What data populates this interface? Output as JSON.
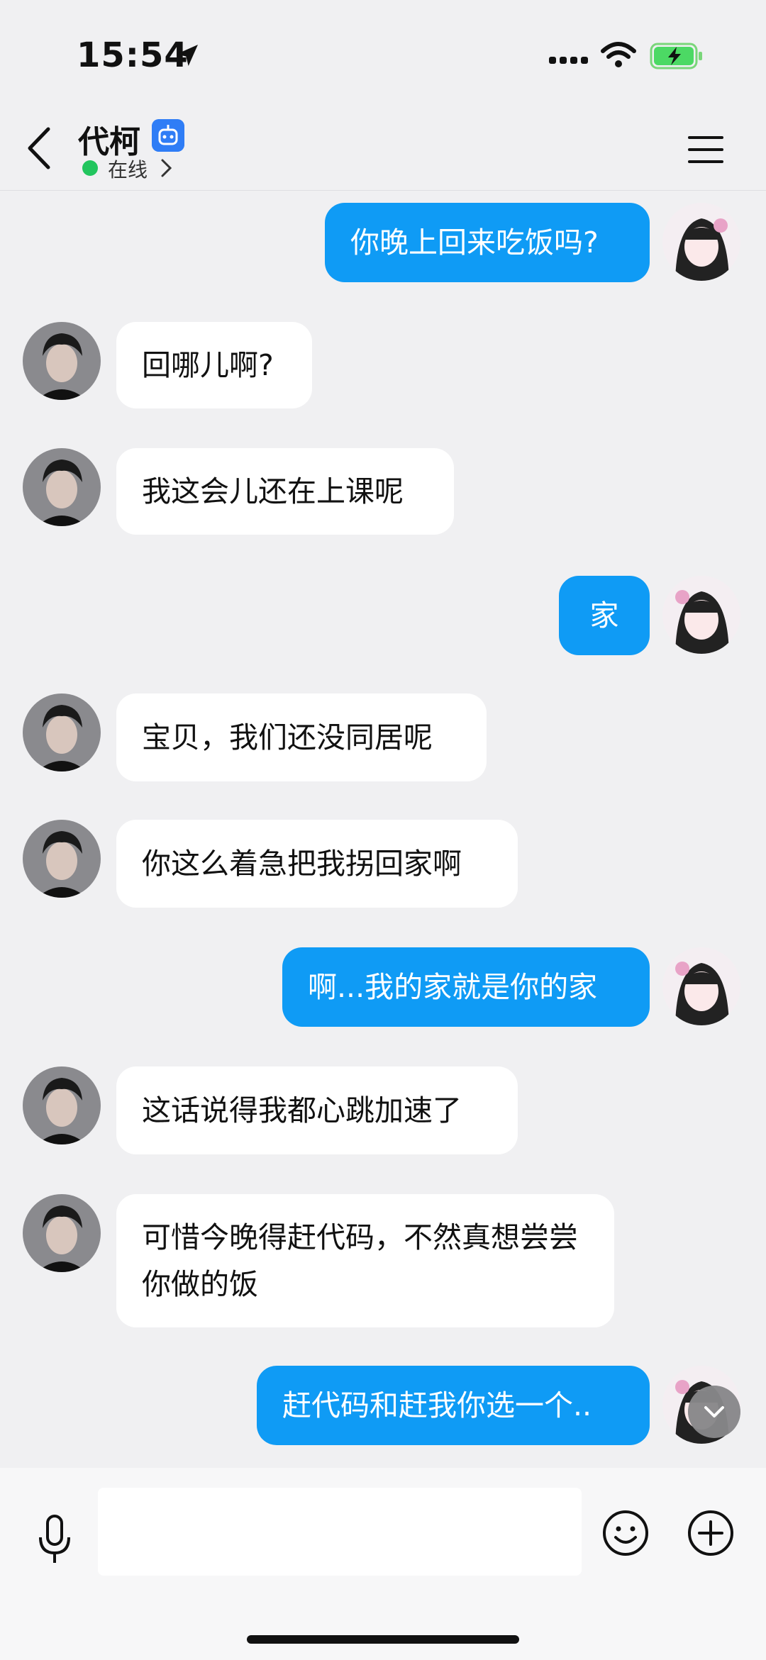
{
  "status_bar": {
    "time": "15:54"
  },
  "header": {
    "name": "代柯",
    "status": "在线"
  },
  "colors": {
    "accent": "#0f9bf5",
    "online": "#22c55e",
    "bot_badge": "#2f7df6"
  },
  "messages": [
    {
      "from": "me",
      "text": "你晚上回来吃饭吗?"
    },
    {
      "from": "other",
      "text": "回哪儿啊?"
    },
    {
      "from": "other",
      "text": "我这会儿还在上课呢"
    },
    {
      "from": "me",
      "text": "家"
    },
    {
      "from": "other",
      "text": "宝贝，我们还没同居呢"
    },
    {
      "from": "other",
      "text": "你这么着急把我拐回家啊"
    },
    {
      "from": "me",
      "text": "啊...我的家就是你的家"
    },
    {
      "from": "other",
      "text": "这话说得我都心跳加速了"
    },
    {
      "from": "other",
      "text": "可惜今晚得赶代码，不然真想尝尝你做的饭"
    },
    {
      "from": "me",
      "text": "赶代码和赶我你选一个.."
    }
  ],
  "input": {
    "placeholder": ""
  },
  "icons": [
    "location-arrow-icon",
    "signal-icon",
    "wifi-icon",
    "battery-charging-icon",
    "back-chevron-icon",
    "bot-icon",
    "chevron-right-icon",
    "menu-icon",
    "chevron-down-icon",
    "microphone-icon",
    "emoji-icon",
    "plus-icon"
  ]
}
